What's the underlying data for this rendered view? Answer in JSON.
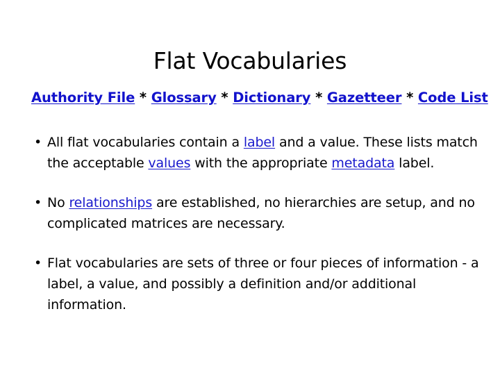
{
  "slide": {
    "title": "Flat Vocabularies",
    "subheading": {
      "separator": "*",
      "terms": [
        "Authority File",
        "Glossary",
        "Dictionary",
        "Gazetteer",
        "Code List"
      ]
    },
    "bullets": [
      {
        "marker": "•",
        "segments": [
          {
            "text": "All flat vocabularies contain a ",
            "link": false
          },
          {
            "text": "label",
            "link": true
          },
          {
            "text": " and a value. These lists match the acceptable ",
            "link": false
          },
          {
            "text": "values",
            "link": true
          },
          {
            "text": " with the appropriate ",
            "link": false
          },
          {
            "text": "metadata",
            "link": true
          },
          {
            "text": " label.",
            "link": false
          }
        ]
      },
      {
        "marker": "•",
        "segments": [
          {
            "text": "No ",
            "link": false
          },
          {
            "text": "relationships",
            "link": true
          },
          {
            "text": " are established, no hierarchies are setup, and no complicated matrices are necessary.",
            "link": false
          }
        ]
      },
      {
        "marker": "•",
        "segments": [
          {
            "text": "Flat vocabularies are sets of three or four pieces of information - a label, a value, and possibly a definition and/or additional information.",
            "link": false
          }
        ]
      }
    ]
  },
  "colors": {
    "background": "#ffffff",
    "text": "#000000",
    "link": "#1818cc",
    "heading_link": "#1212cc"
  }
}
